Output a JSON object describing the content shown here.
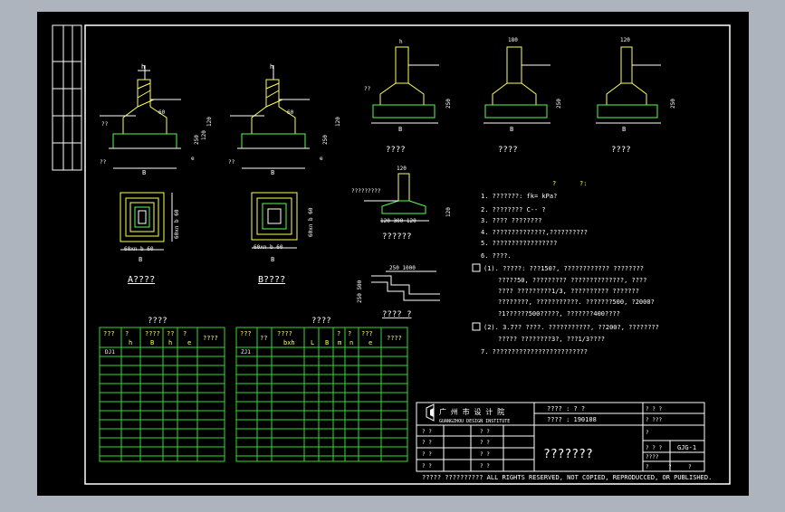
{
  "colors": {
    "background": "#aeb4bd",
    "canvas": "#000000",
    "line": "#ffffff",
    "table": "#33dd33",
    "text_yellow": "#ffff55",
    "dim_green": "#55ff55"
  },
  "sections": {
    "footing_a": "????",
    "footing_b": "????",
    "plan_a": "A????",
    "plan_b": "B????",
    "detail": "??????",
    "step": "???? ?",
    "table_a": "????",
    "table_b": "????"
  },
  "labels": {
    "h": "h",
    "b": "B",
    "e": "e",
    "q": "??",
    "slope": "60",
    "dim_a1": "250",
    "dim_a2": "120",
    "dim_a3": "120",
    "col_180": "180",
    "col_120": "120",
    "col_h": "h",
    "plan_a_dims": "60xn b 60",
    "plan_a_side": "60xn b 60",
    "plan_b_dims": "60xn b 60",
    "pile_top": "120",
    "pile_dims": "120 300 120",
    "pile_side": "120",
    "pile_label": "?????????",
    "step_dims": "250 1000",
    "step_side": "250 500",
    "yellow_qmark1": "?",
    "yellow_qmark2": "?:"
  },
  "notes": [
    "1. ???????: fk=     kPa?",
    "2. ????????  C-- ?",
    "3. ???? ????????",
    "4. ??????????????,??????????",
    "5. ?????????????????",
    "6. ????.",
    "(1). ?????: ???150?, ???????????? ????????",
    "?????50, ????????? ??????????????, ????",
    "???? ?????????1/3, ?????????? ???????",
    "????????, ???????????. ???????500, ?2000?",
    "?1??????500?????, ???????400????",
    "(2). 3.7?? ????. ???????????, ??200?, ????????",
    "????? ????????3?, ???1/3????",
    "7. ?????????????????????????"
  ],
  "table_a": {
    "headers": [
      "???",
      "?",
      "????",
      "??",
      "?",
      "????"
    ],
    "subheaders": [
      "?",
      "h",
      "B",
      "h",
      "e",
      ""
    ],
    "first_row": "DJ1"
  },
  "table_b": {
    "headers": [
      "???",
      "??",
      "????",
      "?",
      "?",
      "???",
      "????"
    ],
    "subheaders": [
      "?",
      "",
      "bxh",
      "L",
      "B",
      "m",
      "n",
      "e"
    ],
    "first_row": "ZJ1"
  },
  "title_block": {
    "institute_cn": "广 州 市 设 计 院",
    "institute_en": "GUANGZHOU DESIGN INSTITUTE",
    "project_row": "???? : ?   ?",
    "number_row": "???? : 190108",
    "drawing_title": "???????",
    "drawing_no": "GJG-1",
    "left_cells": [
      "? ?",
      "? ?",
      "? ?",
      "? ?"
    ],
    "mid_cells": [
      "? ?",
      "? ?",
      "? ?",
      "? ?"
    ],
    "right_cells": [
      "? ? ?",
      "? ???",
      "?",
      "? ? ?",
      "????"
    ],
    "bottom_row": [
      "?",
      "?",
      "?"
    ],
    "footer": "????? ??????????   ALL RIGHTS RESERVED, NOT COPIED, REPRODUCCED, OR PUBLISHED."
  }
}
